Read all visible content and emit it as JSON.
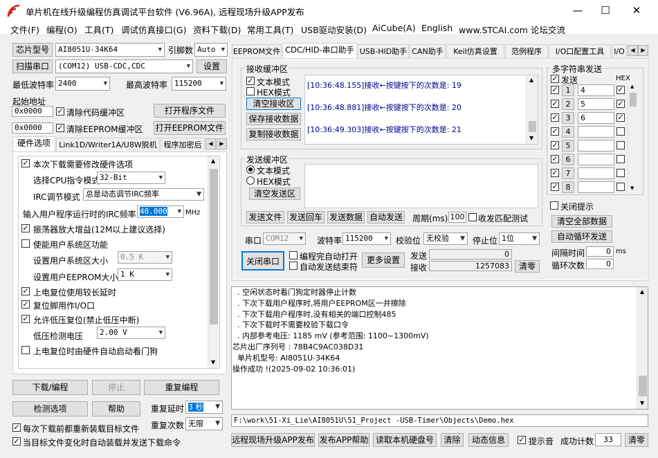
{
  "window": {
    "title": "单片机在线升级编程仿真调试平台软件 (V6.96A), 远程现场升级APP发布",
    "minimize": "—",
    "maximize": "☐",
    "close": "✕"
  },
  "menu": [
    "文件(F)",
    "编程(O)",
    "工具(T)",
    "调试仿真接口(G)",
    "资料下载(D)",
    "常用工具(T)",
    "USB驱动安装(D)",
    "AiCube(A)",
    "English",
    "www.STCAI.com 论坛交流"
  ],
  "left": {
    "chip_btn": "芯片型号",
    "chip_value": "AI8051U-34K64",
    "pin_label": "引脚数",
    "pin_value": "Auto",
    "scan_btn": "扫描串口",
    "port_value": "(COM12) USB-CDC,CDC",
    "settings_btn": "设置",
    "min_baud_label": "最低波特率",
    "min_baud_value": "2400",
    "max_baud_label": "最高波特率",
    "max_baud_value": "115200",
    "start_addr_label": "起始地址",
    "addr1": "0x0000",
    "clear_code_label": "清除代码缓冲区",
    "open_prog_btn": "打开程序文件",
    "addr2": "0x0000",
    "clear_eeprom_label": "清除EEPROM缓冲区",
    "open_eeprom_btn": "打开EEPROM文件",
    "tabs": [
      "硬件选项",
      "Link1D/Writer1A/U8W脱机",
      "程序加密后"
    ],
    "hw": {
      "modify_label": "本次下载需要修改硬件选项",
      "cpu_mode_label": "选择CPU指令模式",
      "cpu_mode_value": "32-Bit",
      "irc_mode_label": "IRC调节模式",
      "irc_mode_value": "总是动态调节IRC频率",
      "irc_freq_label": "输入用户程序运行时的IRC频率",
      "irc_freq_value": "40.000",
      "irc_unit": "MHz",
      "osc_gain_label": "振荡器放大增益(12M以上建议选择)",
      "sys_area_label": "使能用户系统区功能",
      "sys_size_label": "设置用户系统区大小",
      "sys_size_value": "0.5 K",
      "eeprom_size_label": "设置用户EEPROM大小",
      "eeprom_size_value": "1   K",
      "long_reset_label": "上电复位使用较长延时",
      "reset_io_label": "复位脚用作I/O口",
      "low_volt_label": "允许低压复位(禁止低压中断)",
      "lv_detect_label": "低压检测电压",
      "lv_detect_value": "2.00 V",
      "wdt_label": "上电复位时由硬件自动启动看门狗"
    },
    "download_btn": "下载/编程",
    "stop_btn": "停止",
    "reprog_btn": "重复编程",
    "detect_btn": "检测选项",
    "help_btn": "帮助",
    "repeat_delay_label": "重复延时",
    "repeat_delay_value": "3 秒",
    "repeat_count_label": "重复次数",
    "repeat_count_value": "无限",
    "reload_label": "每次下载前都重新装载目标文件",
    "auto_reload_label": "当目标文件变化时自动装载并发送下载命令"
  },
  "right": {
    "tabs": [
      "EEPROM文件",
      "CDC/HID-串口助手",
      "USB-HID助手",
      "CAN助手",
      "Keil仿真设置",
      "范例程序",
      "I/O口配置工具",
      "I/O"
    ],
    "recv": {
      "title": "接收缓冲区",
      "text_mode": "文本模式",
      "hex_mode": "HEX模式",
      "clear_btn": "清空接收区",
      "save_btn": "保存接收数据",
      "copy_btn": "复制接收数据",
      "lines": [
        "[10:36:48.155]接收←按键按下的次数是: 19",
        "[10:36:48.881]接收←按键按下的次数是: 20",
        "[10:36:49.303]接收←按键按下的次数是: 21"
      ]
    },
    "send": {
      "title": "发送缓冲区",
      "text_mode": "文本模式",
      "hex_mode": "HEX模式",
      "clear_btn": "清空发送区",
      "send_file_btn": "发送文件",
      "send_return_btn": "发送回车",
      "send_data_btn": "发送数据",
      "auto_send_btn": "自动发送",
      "period_label": "周期(ms)",
      "period_value": "100",
      "match_label": "收发匹配测试"
    },
    "port_label": "串口",
    "port_value": "COM12",
    "baud_label": "波特率",
    "baud_value": "115200",
    "parity_label": "校验位",
    "parity_value": "无校验",
    "stop_label": "停止位",
    "stop_value": "1位",
    "close_port_btn": "关闭串口",
    "auto_open_label": "编程完自动打开",
    "auto_end_label": "自动发送结束符",
    "more_btn": "更多设置",
    "send_count_label": "发送",
    "send_count": "0",
    "recv_count_label": "接收",
    "recv_count": "1257083",
    "clear_count_btn": "清零",
    "multi": {
      "title": "多字符串发送",
      "send_header": "发送",
      "hex_header": "HEX",
      "rows": [
        {
          "num": "1",
          "value": "4"
        },
        {
          "num": "2",
          "value": "5"
        },
        {
          "num": "3",
          "value": "6"
        },
        {
          "num": "4",
          "value": ""
        },
        {
          "num": "5",
          "value": ""
        },
        {
          "num": "6",
          "value": ""
        },
        {
          "num": "7",
          "value": ""
        },
        {
          "num": "8",
          "value": ""
        }
      ],
      "close_tip_label": "关闭提示",
      "clear_all_btn": "清空全部数据",
      "auto_loop_btn": "自动循环发送",
      "interval_label": "间隔时间",
      "interval_value": "0",
      "interval_unit": "ms",
      "loop_count_label": "循环次数",
      "loop_count_value": "0"
    },
    "log": [
      "  . 空闲状态时看门狗定时器停止计数",
      "  . 下次下载用户程序时,将用户EEPROM区一并擦除",
      "  . 下次下载用户程序时,没有相关的端口控制485",
      "  . 下次下载时不需要校验下载口令",
      "  . 内部参考电压: 1185 mV (参考范围: 1100~1300mV)",
      "芯片出厂序列号 : 78B4C9AC038D31",
      "",
      "  单片机型号: AI8051U-34K64",
      "",
      "操作成功 !(2025-09-02 10:36:01)"
    ],
    "path": "F:\\work\\51-Xi_Lie\\AI8051U\\51_Project -USB-Timer\\Objects\\Demo.hex"
  },
  "bottom": {
    "publish_btn": "远程现场升级APP发布",
    "publish_help_btn": "发布APP帮助",
    "read_disk_btn": "读取本机硬盘号",
    "clear_btn": "清除",
    "anim_btn": "动态信息",
    "beep_label": "提示音",
    "success_label": "成功计数",
    "success_value": "33",
    "reset_btn": "清零"
  }
}
